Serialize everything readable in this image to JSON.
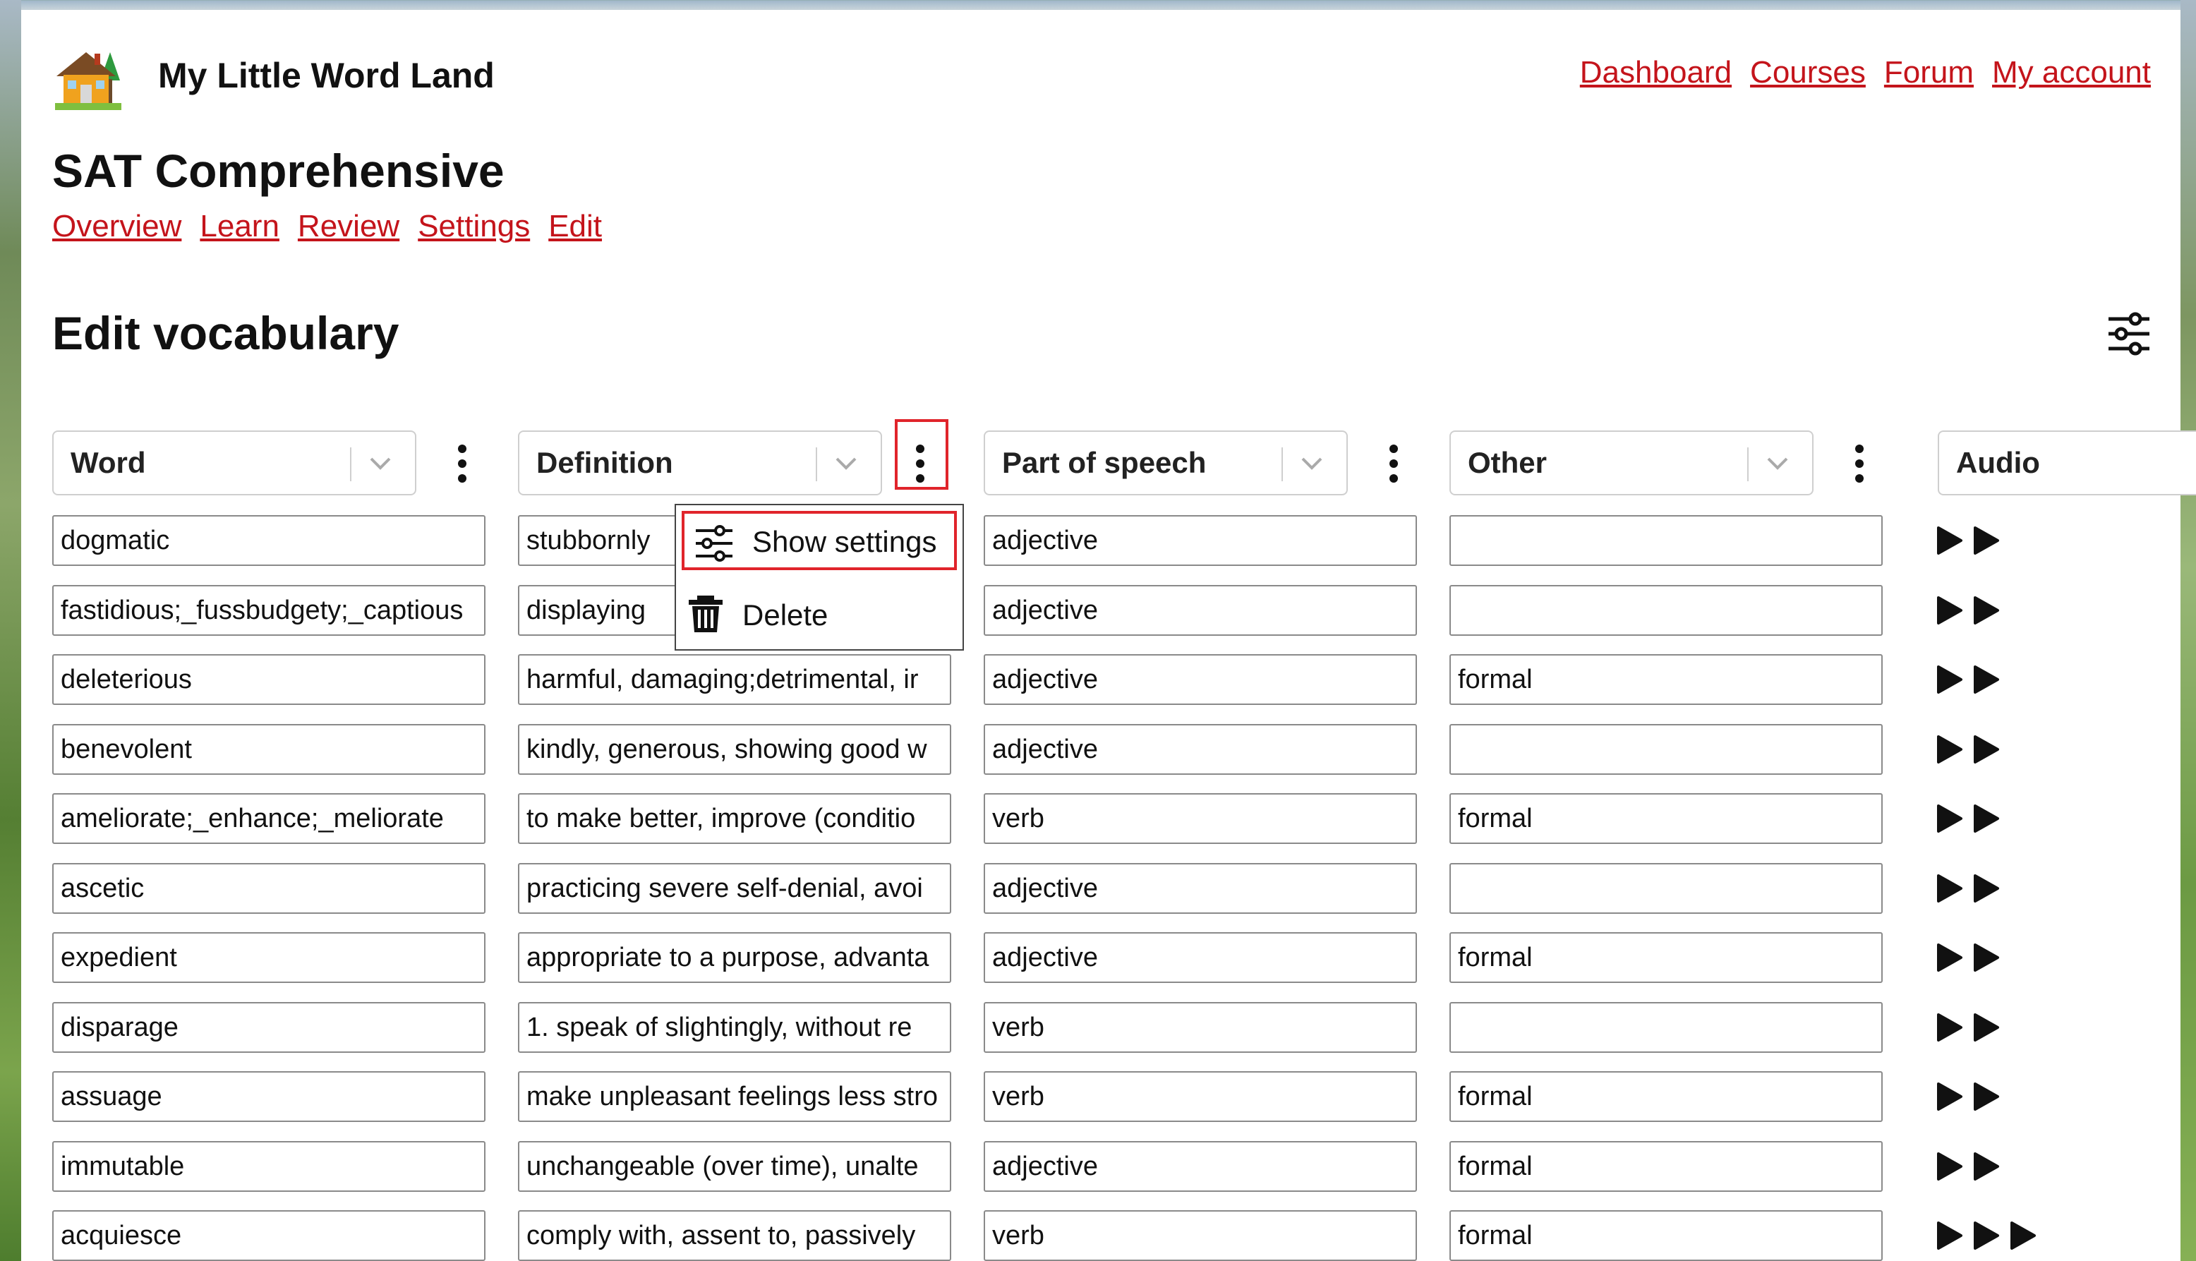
{
  "header": {
    "site_title": "My Little Word Land",
    "nav": [
      "Dashboard",
      "Courses",
      "Forum",
      "My account"
    ]
  },
  "course": {
    "title": "SAT Comprehensive",
    "tabs": [
      "Overview",
      "Learn",
      "Review",
      "Settings",
      "Edit"
    ]
  },
  "section": {
    "title": "Edit vocabulary"
  },
  "columns": [
    "Word",
    "Definition",
    "Part of speech",
    "Other",
    "Audio"
  ],
  "column_menu": {
    "items": [
      "Show settings",
      "Delete"
    ],
    "icons": [
      "sliders-icon",
      "trash-icon"
    ]
  },
  "rows": [
    {
      "word": "dogmatic",
      "definition": "stubbornly",
      "pos": "adjective",
      "other": "",
      "audio_count": 2
    },
    {
      "word": "fastidious;_fussbudgety;_captious",
      "definition": "displaying",
      "pos": "adjective",
      "other": "",
      "audio_count": 2
    },
    {
      "word": "deleterious",
      "definition": "harmful, damaging;detrimental, ir",
      "pos": "adjective",
      "other": "formal",
      "audio_count": 2
    },
    {
      "word": "benevolent",
      "definition": "kindly, generous, showing good w",
      "pos": "adjective",
      "other": "",
      "audio_count": 2
    },
    {
      "word": "ameliorate;_enhance;_meliorate",
      "definition": "to make better, improve (conditio",
      "pos": "verb",
      "other": "formal",
      "audio_count": 2
    },
    {
      "word": "ascetic",
      "definition": "practicing severe self-denial, avoi",
      "pos": "adjective",
      "other": "",
      "audio_count": 2
    },
    {
      "word": "expedient",
      "definition": "appropriate to a purpose, advanta",
      "pos": "adjective",
      "other": "formal",
      "audio_count": 2
    },
    {
      "word": "disparage",
      "definition": "1. speak of slightingly, without re",
      "pos": "verb",
      "other": "",
      "audio_count": 2
    },
    {
      "word": "assuage",
      "definition": "make unpleasant feelings less stro",
      "pos": "verb",
      "other": "formal",
      "audio_count": 2
    },
    {
      "word": "immutable",
      "definition": "unchangeable (over time), unalte",
      "pos": "adjective",
      "other": "formal",
      "audio_count": 2
    },
    {
      "word": "acquiesce",
      "definition": "comply with, assent to, passively",
      "pos": "verb",
      "other": "formal",
      "audio_count": 3
    }
  ],
  "colors": {
    "link": "#c4141b",
    "highlight": "#e0242b"
  }
}
